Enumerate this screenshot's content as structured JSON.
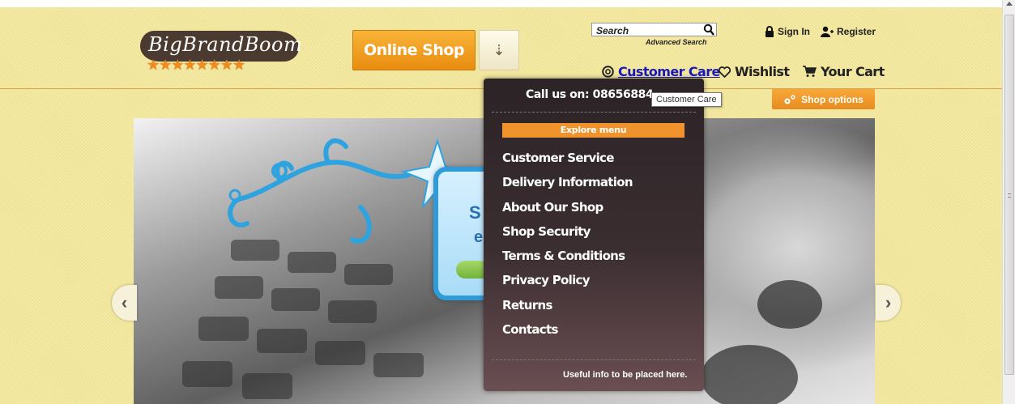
{
  "header": {
    "logo_text": "BigBrandBoom",
    "logo_stars": "★★★★★★★★",
    "online_shop_label": "Online Shop",
    "shop_arrow_glyph": "⇣"
  },
  "search": {
    "placeholder": "Search",
    "advanced_label": "Advanced Search"
  },
  "account": {
    "sign_in_label": "Sign In",
    "register_label": "Register"
  },
  "nav": {
    "customer_care_label": "Customer Care",
    "wishlist_label": "Wishlist",
    "cart_label": "Your Cart"
  },
  "shop_options_label": "Shop options",
  "tooltip_text": "Customer Care",
  "dropdown": {
    "call_label": "Call us on: 08656884",
    "explore_label": "Explore menu",
    "items": [
      "Customer Service",
      "Delivery Information",
      "About Our Shop",
      "Shop Security",
      "Terms & Conditions",
      "Privacy Policy",
      "Returns",
      "Contacts"
    ],
    "footer": "Useful info to be placed here."
  },
  "banner": {
    "card_text_1": "S",
    "card_text_2": "el",
    "prev_glyph": "‹",
    "next_glyph": "›"
  },
  "colors": {
    "page_bg": "#f2e79c",
    "accent_orange": "#f1932d",
    "link_blue": "#1a18b8",
    "dropdown_bg": "#2c2326"
  }
}
